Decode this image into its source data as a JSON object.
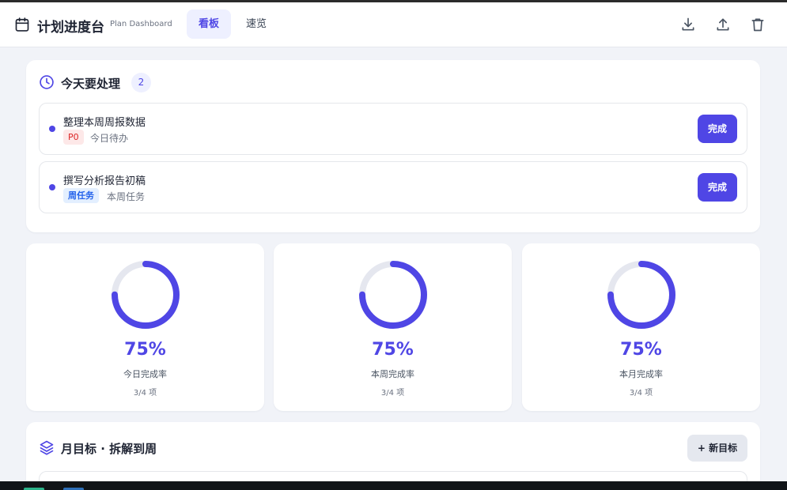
{
  "header": {
    "title": "计划进度台",
    "subtitle": "Plan Dashboard",
    "tabs": [
      {
        "label": "看板",
        "active": true
      },
      {
        "label": "速览",
        "active": false
      }
    ],
    "icons": [
      "download-icon",
      "upload-icon",
      "trash-icon"
    ]
  },
  "today": {
    "title": "今天要处理",
    "count": "2",
    "tasks": [
      {
        "title": "整理本周周报数据",
        "tag": "P0",
        "meta": "今日待办",
        "action": "完成"
      },
      {
        "title": "撰写分析报告初稿",
        "tag": "周任务",
        "meta": "本周任务",
        "action": "完成"
      }
    ]
  },
  "stats": [
    {
      "percent": "75%",
      "progress": 0.75,
      "label": "今日完成率",
      "count": "3/4 项"
    },
    {
      "percent": "75%",
      "progress": 0.75,
      "label": "本周完成率",
      "count": "3/4 项"
    },
    {
      "percent": "75%",
      "progress": 0.75,
      "label": "本月完成率",
      "count": "3/4 项"
    }
  ],
  "goals": {
    "title": "月目标 · 拆解到周",
    "new_button": "+ 新目标"
  },
  "colors": {
    "accent": "#4f46e5",
    "ring_track": "#e5e7ef",
    "tag_p0_bg": "#fde8e8",
    "tag_p0_text": "#dc2626",
    "tag_week_bg": "#e3efff",
    "tag_week_text": "#2563eb"
  }
}
